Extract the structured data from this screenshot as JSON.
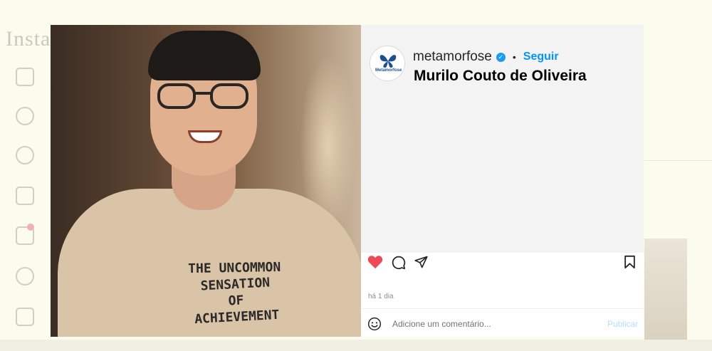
{
  "post": {
    "username": "metamorfose",
    "separator": "•",
    "follow_label": "Seguir",
    "caption_name": "Murilo Couto de Oliveira",
    "avatar_brand": "Metamorfose",
    "timestamp": "há 1 dia",
    "liked": true,
    "like_color": "#ed4956",
    "accent_color": "#0095f6"
  },
  "photo": {
    "shirt_text": [
      "THE UNCOMMON",
      "SENSATION",
      "OF",
      "ACHIEVEMENT"
    ]
  },
  "comment": {
    "placeholder": "Adicione um comentário...",
    "publish_label": "Publicar"
  },
  "icons": {
    "like": "heart-icon",
    "comment": "comment-icon",
    "share": "share-icon",
    "save": "bookmark-icon",
    "verified": "verified-badge-icon",
    "emoji": "emoji-icon"
  }
}
